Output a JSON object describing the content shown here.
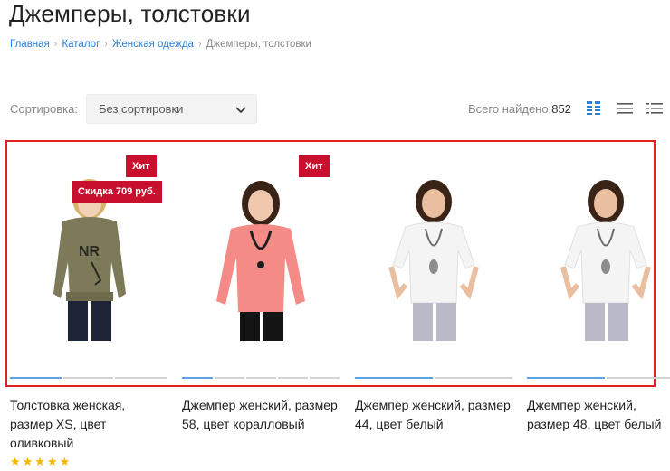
{
  "page": {
    "title": "Джемперы, толстовки"
  },
  "breadcrumb": {
    "items": [
      "Главная",
      "Каталог",
      "Женская одежда"
    ],
    "current": "Джемперы, толстовки"
  },
  "sort": {
    "label": "Сортировка:",
    "selected": "Без сортировки"
  },
  "results": {
    "label": "Всего найдено:",
    "count": "852"
  },
  "view_modes": [
    "grid-view-icon",
    "list-view-icon",
    "table-view-icon"
  ],
  "colors": {
    "accent": "#2a7fd4",
    "badge": "#c8102e",
    "highlight": "#e0201e",
    "star": "#f5b400"
  },
  "products": [
    {
      "name": "Толстовка женская, размер XS, цвет оливковый",
      "badges": [
        "Хит",
        "Скидка 709 руб."
      ],
      "rating": "★★★★★",
      "image_color": "#7d7a5a"
    },
    {
      "name": "Джемпер женский, размер 58, цвет коралловый",
      "badges": [
        "Хит"
      ],
      "image_color": "#f58b86"
    },
    {
      "name": "Джемпер женский, размер 44, цвет белый",
      "badges": [],
      "image_color": "#f4f4f4"
    },
    {
      "name": "Джемпер женский, размер 48, цвет белый",
      "badges": [],
      "image_color": "#f4f4f4"
    }
  ]
}
